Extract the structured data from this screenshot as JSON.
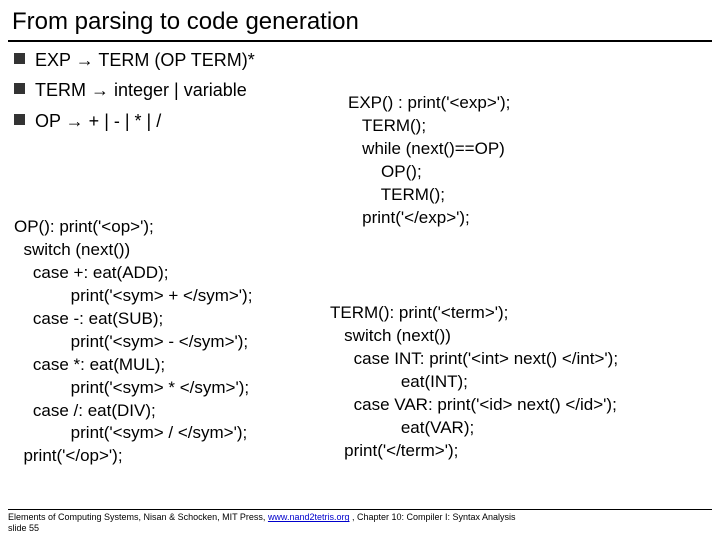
{
  "title": "From parsing to code generation",
  "bullets": {
    "b1": "EXP → TERM (OP TERM)*",
    "b2": "TERM → integer | variable",
    "b3": "OP → + | - | * | /"
  },
  "op_code": "OP(): print('<op>');\n  switch (next())\n    case +: eat(ADD);\n            print('<sym> + </sym>');\n    case -: eat(SUB);\n            print('<sym> - </sym>');\n    case *: eat(MUL);\n            print('<sym> * </sym>');\n    case /: eat(DIV);\n            print('<sym> / </sym>');\n  print('</op>');",
  "exp_code": "EXP() : print('<exp>');\n   TERM();\n   while (next()==OP)\n       OP();\n       TERM();\n   print('</exp>');",
  "term_code": "TERM(): print('<term>');\n   switch (next())\n     case INT: print('<int> next() </int>');\n               eat(INT);\n     case VAR: print('<id> next() </id>');\n               eat(VAR);\n   print('</term>');",
  "footnote": {
    "text_before": "Elements of Computing Systems, Nisan & Schocken, MIT Press, ",
    "link": "www.nand2tetris.org",
    "text_after": " , Chapter 10: Compiler I: Syntax Analysis",
    "slide": "slide 55"
  }
}
